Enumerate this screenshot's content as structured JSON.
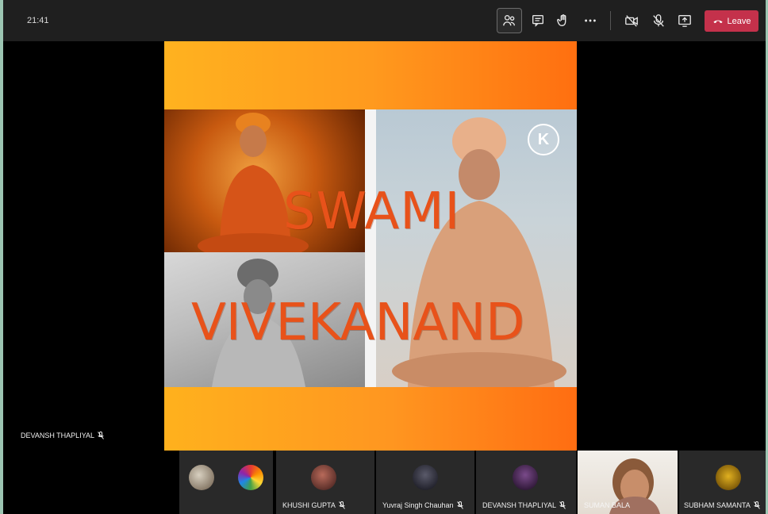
{
  "header": {
    "time": "21:41",
    "leave_label": "Leave"
  },
  "toolbar_icons": [
    "participants-icon",
    "chat-icon",
    "raise-hand-icon",
    "more-options-icon",
    "camera-off-icon",
    "mic-off-icon",
    "share-screen-icon"
  ],
  "slide": {
    "title_line1": "SWAMI",
    "title_line2": "VIVEKANAND",
    "watermark_letter": "K"
  },
  "main_speaker": {
    "name": "DEVANSH THAPLIYAL"
  },
  "participants": [
    {
      "name": "",
      "avatar": "photo"
    },
    {
      "name": "",
      "avatar": "rainbow"
    },
    {
      "name": "KHUSHI GUPTA",
      "avatar": "photo"
    },
    {
      "name": "Yuvraj Singh Chauhan",
      "avatar": "photo"
    },
    {
      "name": "DEVANSH THAPLIYAL",
      "avatar": "photo"
    },
    {
      "name": "SUMAN BALA",
      "avatar": "video"
    },
    {
      "name": "SUBHAM SAMANTA",
      "avatar": "badge"
    }
  ],
  "colors": {
    "leave_button": "#c4314b",
    "title_text": "#e8521a",
    "slide_accent": "#ff8c1a"
  }
}
